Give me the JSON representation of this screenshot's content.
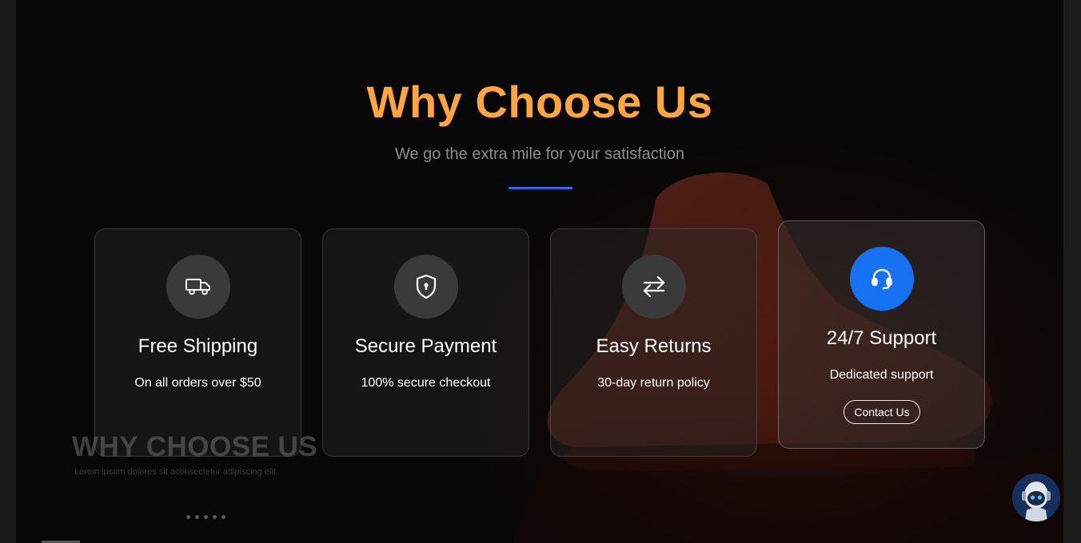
{
  "section": {
    "title": "Why Choose Us",
    "subtitle": "We go the extra mile for your satisfaction"
  },
  "features": [
    {
      "icon": "truck-icon",
      "title": "Free Shipping",
      "desc": "On all orders over $50"
    },
    {
      "icon": "shield-icon",
      "title": "Secure Payment",
      "desc": "100% secure checkout"
    },
    {
      "icon": "exchange-arrows-icon",
      "title": "Easy Returns",
      "desc": "30-day return policy"
    },
    {
      "icon": "headset-icon",
      "title": "24/7 Support",
      "desc": "Dedicated support",
      "button": "Contact Us"
    }
  ],
  "slide": {
    "title": "WHY CHOOSE US",
    "subtitle": "Lorem ipsum dolores sit aconsectetur adipiscing elit.",
    "dot_count": 5
  },
  "colors": {
    "accent": "#ffa53d",
    "divider": "#2f67e8",
    "active_icon": "#1672f3"
  },
  "chatbot": {
    "icon": "robot-assistant-icon"
  }
}
